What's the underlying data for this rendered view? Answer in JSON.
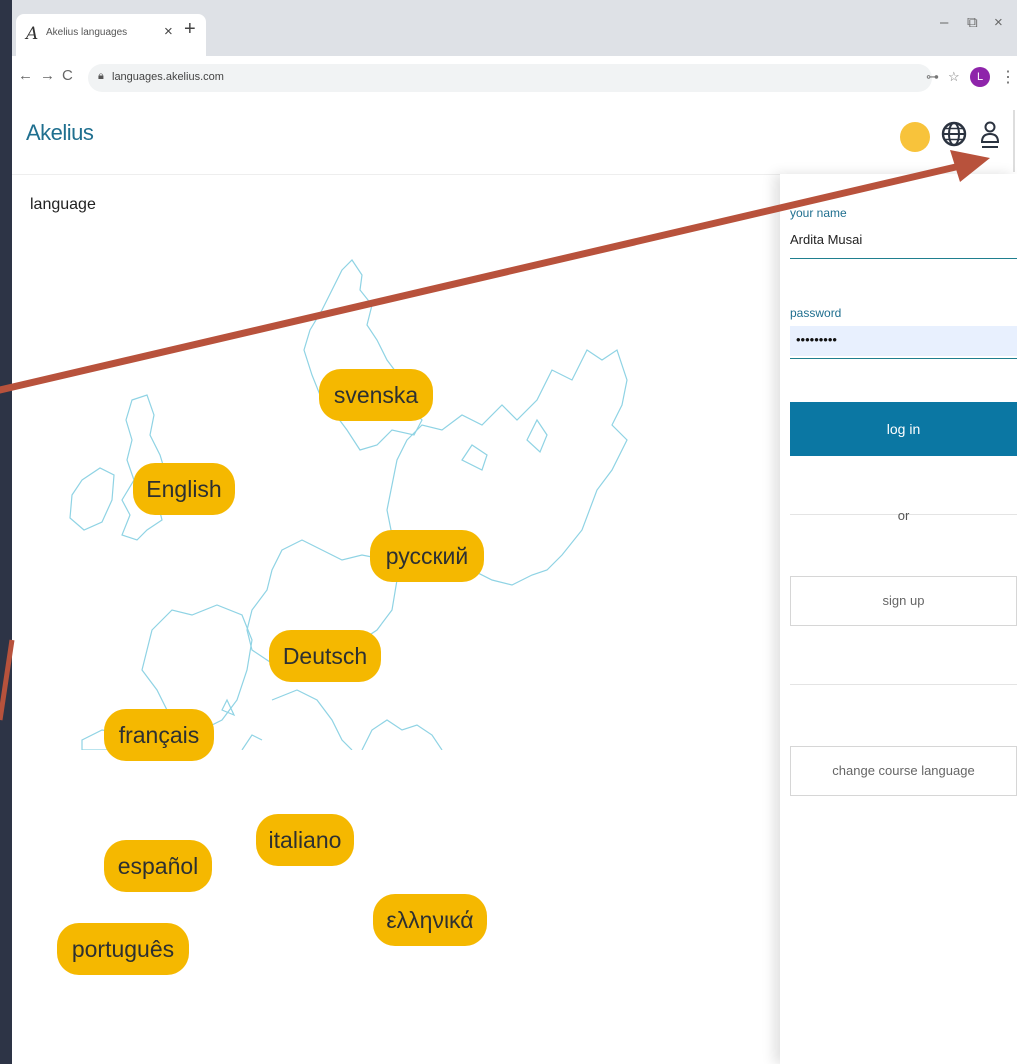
{
  "browser": {
    "tab_title": "Akelius languages",
    "tab_favicon": "A",
    "tab_close": "×",
    "new_tab": "+",
    "url": "languages.akelius.com",
    "minimize": "–",
    "restore": "⧉",
    "close": "×",
    "profile_initial": "L"
  },
  "header": {
    "logo_text": "Akelius"
  },
  "main": {
    "language_label": "language",
    "languages": [
      "svenska",
      "English",
      "русский",
      "Deutsch",
      "français",
      "italiano",
      "español",
      "ελληνικά",
      "português"
    ]
  },
  "login": {
    "name_label": "your name",
    "name_value": "Ardita Musai",
    "password_label": "password",
    "password_value": "•••••••••",
    "login_button": "log in",
    "or_text": "or",
    "signup_button": "sign up",
    "change_course_button": "change course language"
  },
  "colors": {
    "pill": "#f5b800",
    "accent": "#0b77a3",
    "arrow": "#b8523c",
    "frame": "#2d3446"
  }
}
